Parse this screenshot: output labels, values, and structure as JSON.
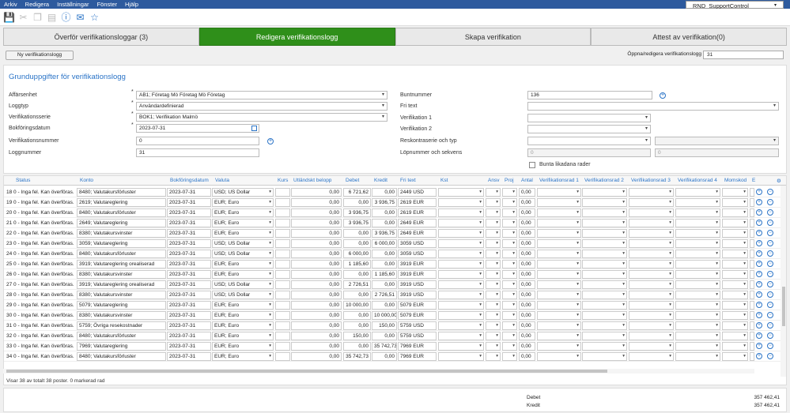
{
  "menu": [
    "Arkiv",
    "Redigera",
    "Inställningar",
    "Fönster",
    "Hjälp"
  ],
  "profile": "RND_SupportControl",
  "toolbar_icons": [
    "save-icon",
    "cut-icon",
    "copy-icon",
    "paste-icon",
    "help-icon",
    "chat-icon",
    "star-icon"
  ],
  "tabs": [
    "Överför verifikationsloggar (3)",
    "Redigera verifikationslogg",
    "Skapa verifikation",
    "Attest av verifikation(0)"
  ],
  "new_log_button": "Ny verifikationslogg",
  "open_label": "Öppna/redigera verifikationslogg",
  "open_value": "31",
  "section_title": "Grunduppgifter för verifikationslogg",
  "form": {
    "affarsenhet_label": "Affärsenhet",
    "affarsenhet": "AB1; Företag Mö Företag Mö Företag",
    "loggtyp_label": "Loggtyp",
    "loggtyp": "Användardefinierad",
    "serie_label": "Verifikationsserie",
    "serie": "BOK1; Verifikation Malmö",
    "datum_label": "Bokföringsdatum",
    "datum": "2023-07-31",
    "vernr_label": "Verifikationsnummer",
    "vernr": "0",
    "loggnr_label": "Loggnummer",
    "loggnr": "31",
    "bunt_label": "Buntnummer",
    "bunt": "136",
    "fritext_label": "Fri text",
    "ver1_label": "Verifikation 1",
    "ver2_label": "Verifikation 2",
    "resk_label": "Reskontraserie och typ",
    "lop_label": "Löpnummer och sekvens",
    "lop1": "0",
    "lop2": "0",
    "bunta_label": "Bunta likadana rader"
  },
  "columns": [
    "Status",
    "Konto",
    "Bokföringsdatum",
    "Valuta",
    "Kurs",
    "Utländskt belopp",
    "Debet",
    "Kredit",
    "Fri text",
    "Kst",
    "Ansv",
    "Proj",
    "Antal",
    "Verifikationsrad 1",
    "Verifikationsrad 2",
    "Verifikationsrad 3",
    "Verifikationsrad 4",
    "Momskod",
    "E"
  ],
  "rows": [
    {
      "n": "18",
      "status": "0 - Inga fel. Kan överföras.",
      "konto": "8480; Valutakursförluster",
      "datum": "2023-07-31",
      "valuta": "USD; US Dollar",
      "utl": "0,00",
      "debet": "6 721,62",
      "kredit": "0,00",
      "fri": "2449 USD",
      "antal": "0,00"
    },
    {
      "n": "19",
      "status": "0 - Inga fel. Kan överföras.",
      "konto": "2619; Valutareglering",
      "datum": "2023-07-31",
      "valuta": "EUR; Euro",
      "utl": "0,00",
      "debet": "0,00",
      "kredit": "3 936,75",
      "fri": "2619 EUR",
      "antal": "0,00"
    },
    {
      "n": "20",
      "status": "0 - Inga fel. Kan överföras.",
      "konto": "8480; Valutakursförluster",
      "datum": "2023-07-31",
      "valuta": "EUR; Euro",
      "utl": "0,00",
      "debet": "3 936,75",
      "kredit": "0,00",
      "fri": "2619 EUR",
      "antal": "0,00"
    },
    {
      "n": "21",
      "status": "0 - Inga fel. Kan överföras.",
      "konto": "2649; Valutareglering",
      "datum": "2023-07-31",
      "valuta": "EUR; Euro",
      "utl": "0,00",
      "debet": "3 936,75",
      "kredit": "0,00",
      "fri": "2649 EUR",
      "antal": "0,00"
    },
    {
      "n": "22",
      "status": "0 - Inga fel. Kan överföras.",
      "konto": "8380; Valutakursvinster",
      "datum": "2023-07-31",
      "valuta": "EUR; Euro",
      "utl": "0,00",
      "debet": "0,00",
      "kredit": "3 936,75",
      "fri": "2649 EUR",
      "antal": "0,00"
    },
    {
      "n": "23",
      "status": "0 - Inga fel. Kan överföras.",
      "konto": "3059; Valutareglering",
      "datum": "2023-07-31",
      "valuta": "USD; US Dollar",
      "utl": "0,00",
      "debet": "0,00",
      "kredit": "6 000,00",
      "fri": "3059 USD",
      "antal": "0,00"
    },
    {
      "n": "24",
      "status": "0 - Inga fel. Kan överföras.",
      "konto": "8480; Valutakursförluster",
      "datum": "2023-07-31",
      "valuta": "USD; US Dollar",
      "utl": "0,00",
      "debet": "6 000,00",
      "kredit": "0,00",
      "fri": "3059 USD",
      "antal": "0,00"
    },
    {
      "n": "25",
      "status": "0 - Inga fel. Kan överföras.",
      "konto": "3919; Valutareglering orealiserad",
      "datum": "2023-07-31",
      "valuta": "EUR; Euro",
      "utl": "0,00",
      "debet": "1 185,60",
      "kredit": "0,00",
      "fri": "3919 EUR",
      "antal": "0,00"
    },
    {
      "n": "26",
      "status": "0 - Inga fel. Kan överföras.",
      "konto": "8380; Valutakursvinster",
      "datum": "2023-07-31",
      "valuta": "EUR; Euro",
      "utl": "0,00",
      "debet": "0,00",
      "kredit": "1 185,60",
      "fri": "3919 EUR",
      "antal": "0,00"
    },
    {
      "n": "27",
      "status": "0 - Inga fel. Kan överföras.",
      "konto": "3919; Valutareglering orealiserad",
      "datum": "2023-07-31",
      "valuta": "USD; US Dollar",
      "utl": "0,00",
      "debet": "2 726,51",
      "kredit": "0,00",
      "fri": "3919 USD",
      "antal": "0,00"
    },
    {
      "n": "28",
      "status": "0 - Inga fel. Kan överföras.",
      "konto": "8380; Valutakursvinster",
      "datum": "2023-07-31",
      "valuta": "USD; US Dollar",
      "utl": "0,00",
      "debet": "0,00",
      "kredit": "2 726,51",
      "fri": "3919 USD",
      "antal": "0,00"
    },
    {
      "n": "29",
      "status": "0 - Inga fel. Kan överföras.",
      "konto": "5079; Valutareglering",
      "datum": "2023-07-31",
      "valuta": "EUR; Euro",
      "utl": "0,00",
      "debet": "10 000,00",
      "kredit": "0,00",
      "fri": "5079 EUR",
      "antal": "0,00"
    },
    {
      "n": "30",
      "status": "0 - Inga fel. Kan överföras.",
      "konto": "8380; Valutakursvinster",
      "datum": "2023-07-31",
      "valuta": "EUR; Euro",
      "utl": "0,00",
      "debet": "0,00",
      "kredit": "10 000,00",
      "fri": "5079 EUR",
      "antal": "0,00"
    },
    {
      "n": "31",
      "status": "0 - Inga fel. Kan överföras.",
      "konto": "5759; Övriga resekostnader",
      "datum": "2023-07-31",
      "valuta": "EUR; Euro",
      "utl": "0,00",
      "debet": "0,00",
      "kredit": "150,00",
      "fri": "5759 USD",
      "antal": "0,00"
    },
    {
      "n": "32",
      "status": "0 - Inga fel. Kan överföras.",
      "konto": "8480; Valutakursförluster",
      "datum": "2023-07-31",
      "valuta": "EUR; Euro",
      "utl": "0,00",
      "debet": "150,00",
      "kredit": "0,00",
      "fri": "5759 USD",
      "antal": "0,00"
    },
    {
      "n": "33",
      "status": "0 - Inga fel. Kan överföras.",
      "konto": "7969; Valutareglering",
      "datum": "2023-07-31",
      "valuta": "EUR; Euro",
      "utl": "0,00",
      "debet": "0,00",
      "kredit": "35 742,73",
      "fri": "7969 EUR",
      "antal": "0,00"
    },
    {
      "n": "34",
      "status": "0 - Inga fel. Kan överföras.",
      "konto": "8480; Valutakursförluster",
      "datum": "2023-07-31",
      "valuta": "EUR; Euro",
      "utl": "0,00",
      "debet": "35 742,73",
      "kredit": "0,00",
      "fri": "7969 EUR",
      "antal": "0,00"
    }
  ],
  "status_text": "Visar 38 av totalt 38 poster. 0 markerad rad",
  "footer": {
    "debet_label": "Debet",
    "debet": "357 462,41",
    "kredit_label": "Kredit",
    "kredit": "357 462,41"
  }
}
